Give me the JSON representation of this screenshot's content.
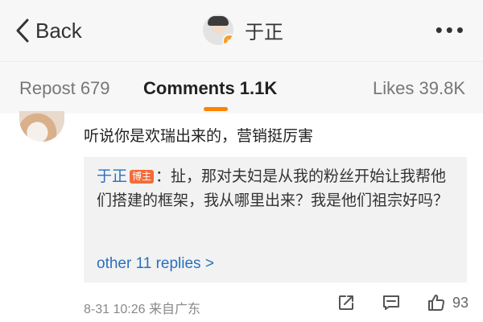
{
  "nav": {
    "back_label": "Back",
    "title": "于正",
    "more_label": "•••"
  },
  "tabs": [
    {
      "label": "Repost 679"
    },
    {
      "label": "Comments 1.1K"
    },
    {
      "label": "Likes 39.8K"
    }
  ],
  "comment": {
    "text": "听说你是欢瑞出来的，营销挺厉害",
    "reply": {
      "author": "于正",
      "badge": "博主",
      "text": "：扯，那对夫妇是从我的粉丝开始让我帮他们搭建的框架，我从哪里出来？我是他们祖宗好吗？"
    },
    "more_replies": "other 11 replies >",
    "meta": "8-31 10:26 来自广东",
    "like_count": "93"
  },
  "colors": {
    "accent": "#ff8200",
    "link": "#2a6fbd",
    "badge": "#f26c3b"
  },
  "icons": [
    "chevron-left-icon",
    "verified-badge-icon",
    "more-dots-icon",
    "share-icon",
    "comment-icon",
    "thumbs-up-icon"
  ]
}
